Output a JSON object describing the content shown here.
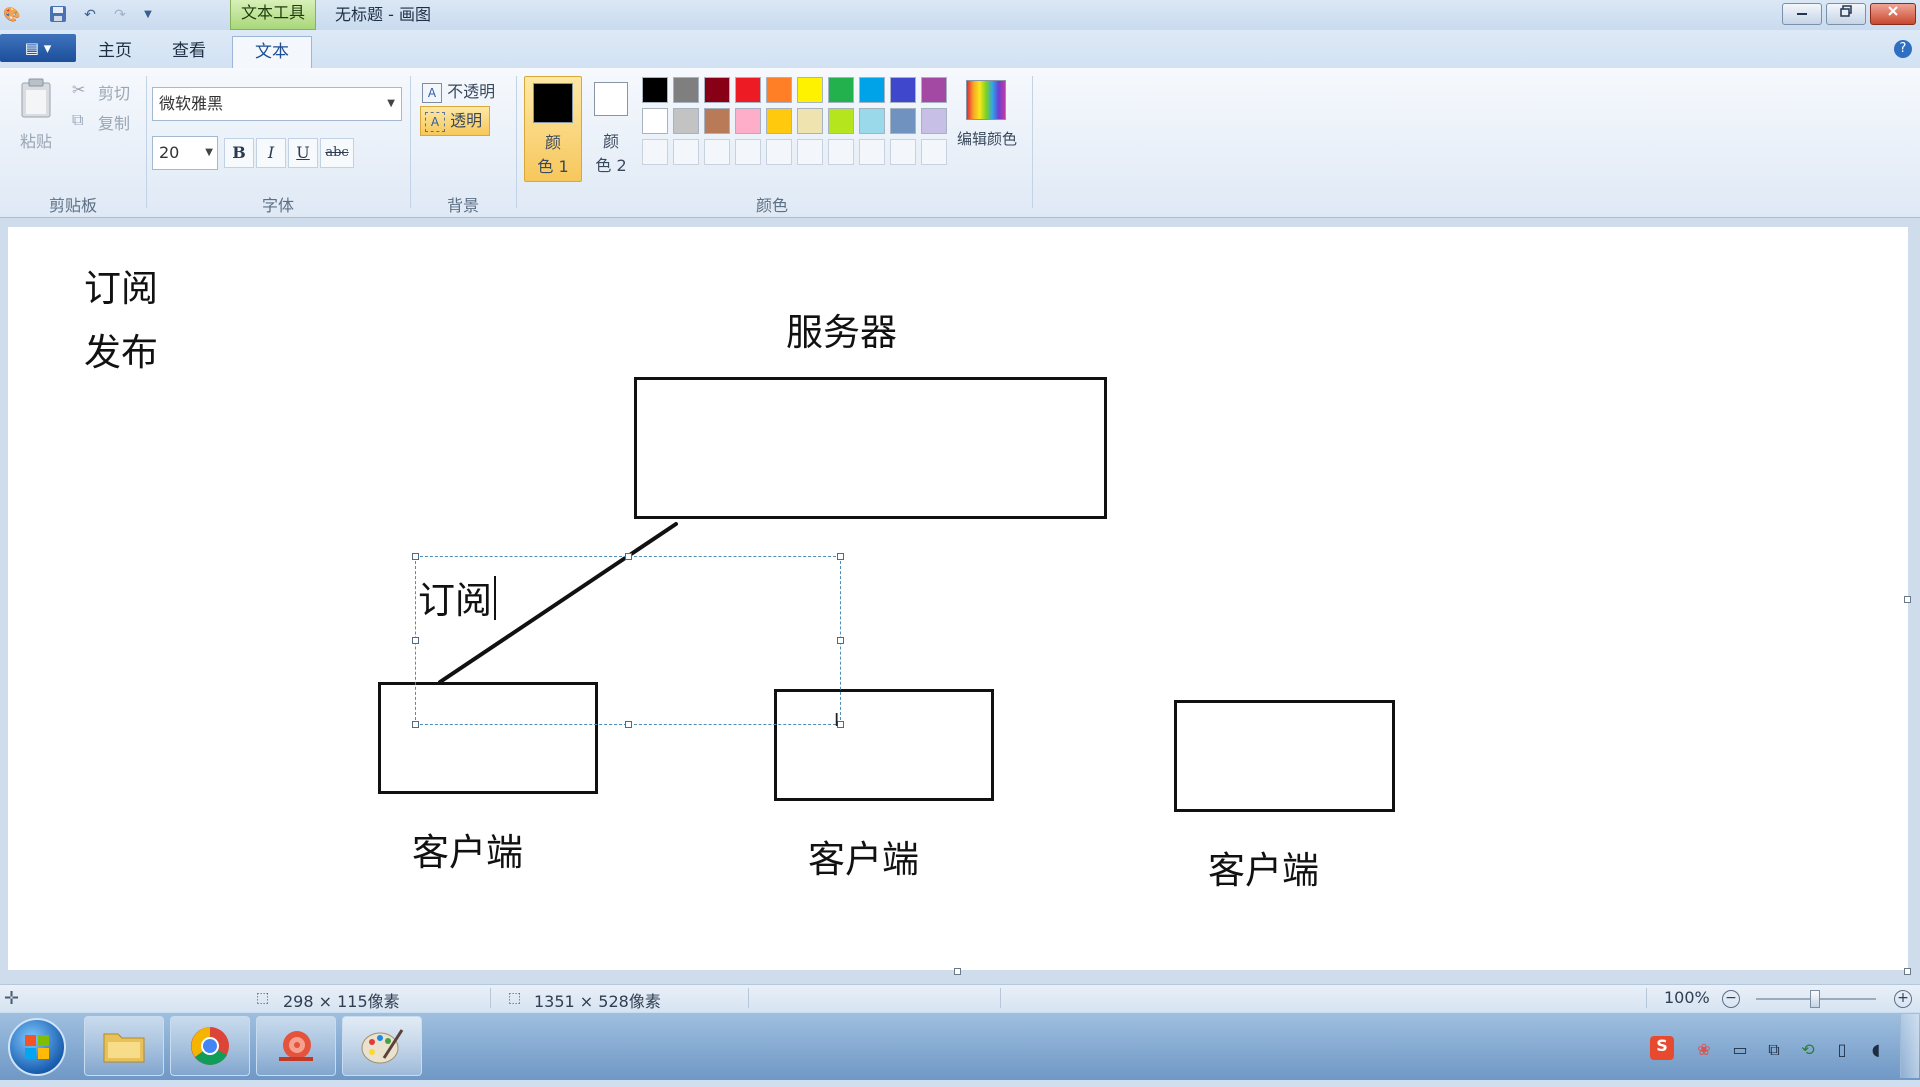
{
  "window": {
    "contextual_tab": "文本工具",
    "title": "无标题 - 画图"
  },
  "tabs": {
    "home": "主页",
    "view": "查看",
    "text": "文本"
  },
  "clipboard": {
    "paste": "粘贴",
    "cut": "剪切",
    "copy": "复制",
    "group": "剪贴板"
  },
  "font": {
    "name": "微软雅黑",
    "size": "20",
    "bold": "B",
    "italic": "I",
    "underline": "U",
    "strike": "abc",
    "group": "字体"
  },
  "background": {
    "opaque": "不透明",
    "transparent": "透明",
    "group": "背景"
  },
  "colors": {
    "color1_top": "颜",
    "color1_bottom": "色 1",
    "color2_top": "颜",
    "color2_bottom": "色 2",
    "edit": "编辑颜色",
    "group": "颜色",
    "color1_value": "#000000",
    "color2_value": "#ffffff",
    "palette_row1": [
      "#000000",
      "#7f7f7f",
      "#880015",
      "#ed1c24",
      "#ff7f27",
      "#fff200",
      "#22b14c",
      "#00a2e8",
      "#3f48cc",
      "#a349a4"
    ],
    "palette_row2": [
      "#ffffff",
      "#c3c3c3",
      "#b97a57",
      "#ffaec9",
      "#ffc90e",
      "#efe4b0",
      "#b5e61d",
      "#99d9ea",
      "#7092be",
      "#c8bfe7"
    ]
  },
  "canvas": {
    "note_subscribe": "订阅",
    "note_publish": "发布",
    "server_label": "服务器",
    "editing_text": "订阅",
    "client_label_1": "客户端",
    "client_label_2": "客户端",
    "client_label_3": "客户端"
  },
  "status": {
    "selection_size": "298 × 115像素",
    "canvas_size": "1351 × 528像素",
    "zoom": "100%"
  }
}
